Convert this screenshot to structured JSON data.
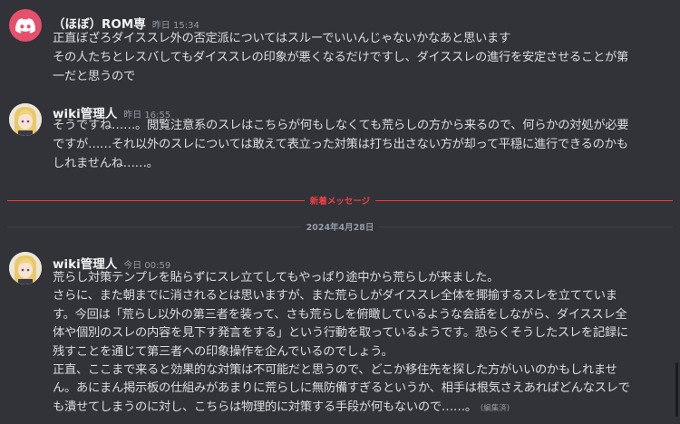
{
  "messages": [
    {
      "username": "（ほぼ）ROM専",
      "timestamp": "昨日 15:34",
      "avatar_icon": "discord-logo-icon",
      "lines": [
        "正直ぼざろダイススレ外の否定派についてはスルーでいいんじゃないかなあと思います",
        "その人たちとレスバしてもダイススレの印象が悪くなるだけですし、ダイススレの進行を安定させることが第",
        "一だと思うので"
      ]
    },
    {
      "username": "wiki管理人",
      "timestamp": "昨日 16:55",
      "avatar_icon": "anime-character-avatar-icon",
      "lines": [
        "そうですね……。閲覧注意系のスレはこちらが何もしなくても荒らしの方から来るので、何らかの対処が必要",
        "ですが……それ以外のスレについては敢えて表立った対策は打ち出さない方が却って平穏に進行できるのかも",
        "しれませんね……。"
      ]
    },
    {
      "username": "wiki管理人",
      "timestamp": "今日 00:59",
      "avatar_icon": "anime-character-avatar-icon",
      "lines": [
        "荒らし対策テンプレを貼らずにスレ立てしてもやっぱり途中から荒らしが来ました。",
        "さらに、また朝までに消されるとは思いますが、また荒らしがダイススレ全体を揶揄するスレを立てていま",
        "す。今回は「荒らし以外の第三者を装って、さも荒らしを俯瞰しているような会話をしながら、ダイススレ全",
        "体や個別のスレの内容を見下す発言をする」という行動を取っているようです。恐らくそうしたスレを記録に",
        "残すことを通じて第三者への印象操作を企んでいるのでしょう。",
        "正直、ここまで来ると効果的な対策は不可能だと思うので、どこか移住先を探した方がいいのかもしれませ",
        "ん。あにまん掲示板の仕組みがあまりに荒らしに無防備すぎるというか、相手は根気さえあればどんなスレで",
        "も潰せてしまうのに対し、こちらは物理的に対策する手段が何もないので……。"
      ],
      "edited": "(編集済)"
    }
  ],
  "dividers": {
    "new_messages": "新着メッセージ",
    "date": "2024年4月28日"
  },
  "colors": {
    "background": "#313338",
    "new_messages_accent": "#f23f43",
    "discord_avatar": "#e5506c"
  }
}
